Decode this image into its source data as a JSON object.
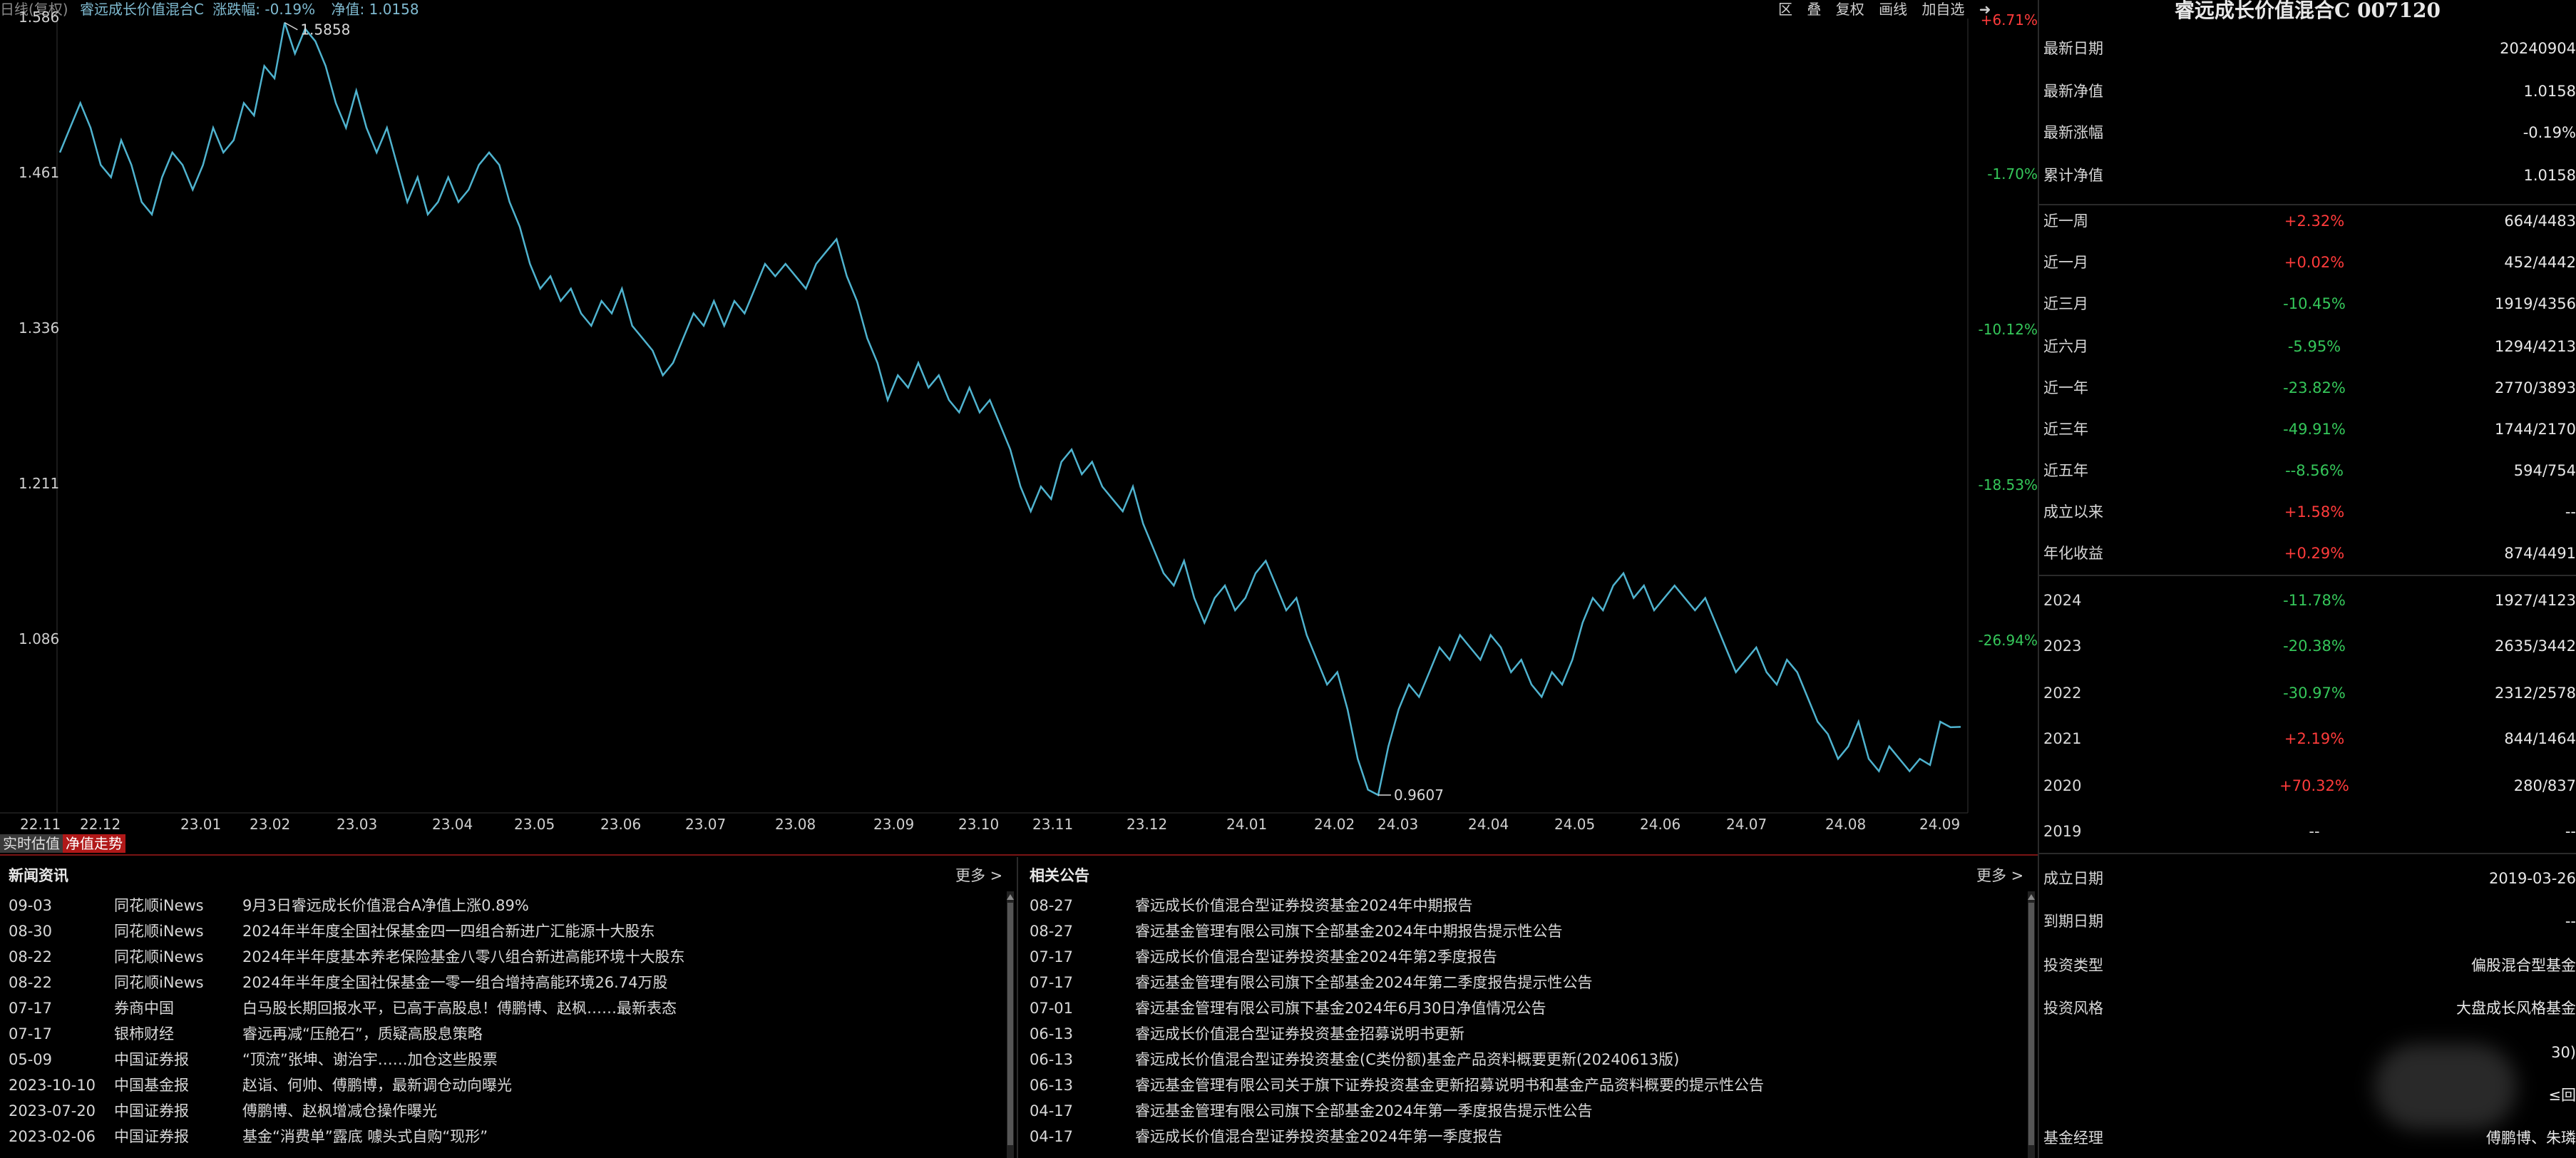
{
  "chart_header": {
    "kline_label": "日线(复权)",
    "fund_name": "睿远成长价值混合C",
    "change_label": "涨跌幅: -0.19%",
    "nav_label": "净值: 1.0158"
  },
  "chart_tools": [
    "区",
    "叠",
    "复权",
    "画线",
    "加自选"
  ],
  "chart_tabs": {
    "realtime": "实时估值",
    "nav_trend": "净值走势"
  },
  "colors": {
    "line": "#4fb3cf",
    "up": "#ff3b3b",
    "down": "#35c75a",
    "background": "#000000"
  },
  "chart_data": {
    "type": "line",
    "title": "",
    "ylim": [
      0.9607,
      1.586
    ],
    "y_ticks": [
      "1.586",
      "1.461",
      "1.336",
      "1.211",
      "1.086"
    ],
    "pct_ticks": [
      {
        "label": "+6.71%",
        "dir": "up",
        "y": 1.586
      },
      {
        "label": "-1.70%",
        "dir": "down",
        "y": 1.461
      },
      {
        "label": "-10.12%",
        "dir": "down",
        "y": 1.336
      },
      {
        "label": "-18.53%",
        "dir": "down",
        "y": 1.211
      },
      {
        "label": "-26.94%",
        "dir": "down",
        "y": 1.086
      }
    ],
    "x_ticks": [
      "22.11",
      "22.12",
      "23.01",
      "23.02",
      "23.03",
      "23.04",
      "23.05",
      "23.06",
      "23.07",
      "23.08",
      "23.09",
      "23.10",
      "23.11",
      "23.12",
      "24.01",
      "24.02",
      "24.03",
      "24.04",
      "24.05",
      "24.06",
      "24.07",
      "24.08",
      "24.09"
    ],
    "max_label": "1.5858",
    "min_label": "0.9607",
    "series": [
      {
        "values": [
          1.48,
          1.5,
          1.52,
          1.5,
          1.47,
          1.46,
          1.49,
          1.47,
          1.44,
          1.43,
          1.46,
          1.48,
          1.47,
          1.45,
          1.47,
          1.5,
          1.48,
          1.49,
          1.52,
          1.51,
          1.55,
          1.54,
          1.585,
          1.56,
          1.58,
          1.57,
          1.55,
          1.52,
          1.5,
          1.53,
          1.5,
          1.48,
          1.5,
          1.47,
          1.44,
          1.46,
          1.43,
          1.44,
          1.46,
          1.44,
          1.45,
          1.47,
          1.48,
          1.47,
          1.44,
          1.42,
          1.39,
          1.37,
          1.38,
          1.36,
          1.37,
          1.35,
          1.34,
          1.36,
          1.35,
          1.37,
          1.34,
          1.33,
          1.32,
          1.3,
          1.31,
          1.33,
          1.35,
          1.34,
          1.36,
          1.34,
          1.36,
          1.35,
          1.37,
          1.39,
          1.38,
          1.39,
          1.38,
          1.37,
          1.39,
          1.4,
          1.41,
          1.38,
          1.36,
          1.33,
          1.31,
          1.28,
          1.3,
          1.29,
          1.31,
          1.29,
          1.3,
          1.28,
          1.27,
          1.29,
          1.27,
          1.28,
          1.26,
          1.24,
          1.21,
          1.19,
          1.21,
          1.2,
          1.23,
          1.24,
          1.22,
          1.23,
          1.21,
          1.2,
          1.19,
          1.21,
          1.18,
          1.16,
          1.14,
          1.13,
          1.15,
          1.12,
          1.1,
          1.12,
          1.13,
          1.11,
          1.12,
          1.14,
          1.15,
          1.13,
          1.11,
          1.12,
          1.09,
          1.07,
          1.05,
          1.06,
          1.03,
          0.99,
          0.965,
          0.9607,
          1.0,
          1.03,
          1.05,
          1.04,
          1.06,
          1.08,
          1.07,
          1.09,
          1.08,
          1.07,
          1.09,
          1.08,
          1.06,
          1.07,
          1.05,
          1.04,
          1.06,
          1.05,
          1.07,
          1.1,
          1.12,
          1.11,
          1.13,
          1.14,
          1.12,
          1.13,
          1.11,
          1.12,
          1.13,
          1.12,
          1.11,
          1.12,
          1.1,
          1.08,
          1.06,
          1.07,
          1.08,
          1.06,
          1.05,
          1.07,
          1.06,
          1.04,
          1.02,
          1.01,
          0.99,
          1.0,
          1.02,
          0.99,
          0.98,
          1.0,
          0.99,
          0.98,
          0.99,
          0.985,
          1.02,
          1.0155,
          1.0158
        ]
      }
    ]
  },
  "info": {
    "title": "睿远成长价值混合C 007120",
    "basic": [
      {
        "label": "最新日期",
        "value": "20240904",
        "dir": ""
      },
      {
        "label": "最新净值",
        "value": "1.0158",
        "dir": ""
      },
      {
        "label": "最新涨幅",
        "value": "-0.19%",
        "dir": "down"
      },
      {
        "label": "累计净值",
        "value": "1.0158",
        "dir": ""
      }
    ],
    "periods": [
      {
        "label": "近一周",
        "change": "+2.32%",
        "rank": "664/4483",
        "dir": "up"
      },
      {
        "label": "近一月",
        "change": "+0.02%",
        "rank": "452/4442",
        "dir": "up"
      },
      {
        "label": "近三月",
        "change": "-10.45%",
        "rank": "1919/4356",
        "dir": "down"
      },
      {
        "label": "近六月",
        "change": "-5.95%",
        "rank": "1294/4213",
        "dir": "down"
      },
      {
        "label": "近一年",
        "change": "-23.82%",
        "rank": "2770/3893",
        "dir": "down"
      },
      {
        "label": "近三年",
        "change": "-49.91%",
        "rank": "1744/2170",
        "dir": "down"
      },
      {
        "label": "近五年",
        "change": "--8.56%",
        "rank": "594/754",
        "dir": "down"
      },
      {
        "label": "成立以来",
        "change": "+1.58%",
        "rank": "--",
        "dir": "up"
      },
      {
        "label": "年化收益",
        "change": "+0.29%",
        "rank": "874/4491",
        "dir": "up"
      }
    ],
    "years": [
      {
        "label": "2024",
        "change": "-11.78%",
        "rank": "1927/4123",
        "dir": "down"
      },
      {
        "label": "2023",
        "change": "-20.38%",
        "rank": "2635/3442",
        "dir": "down"
      },
      {
        "label": "2022",
        "change": "-30.97%",
        "rank": "2312/2578",
        "dir": "down"
      },
      {
        "label": "2021",
        "change": "+2.19%",
        "rank": "844/1464",
        "dir": "up"
      },
      {
        "label": "2020",
        "change": "+70.32%",
        "rank": "280/837",
        "dir": "up"
      },
      {
        "label": "2019",
        "change": "--",
        "rank": "--",
        "dir": ""
      }
    ],
    "profile": [
      {
        "label": "成立日期",
        "value": "2019-03-26"
      },
      {
        "label": "到期日期",
        "value": "--"
      },
      {
        "label": "投资类型",
        "value": "偏股混合型基金"
      },
      {
        "label": "投资风格",
        "value": "大盘成长风格基金"
      },
      {
        "label": "",
        "value": "30)"
      },
      {
        "label": "",
        "value": "≤回"
      },
      {
        "label": "基金经理",
        "value": "傅鹏博、朱璘"
      }
    ]
  },
  "news": {
    "title": "新闻资讯",
    "more": "更多 >",
    "items": [
      {
        "date": "09-03",
        "source": "同花顺iNews",
        "headline": "9月3日睿远成长价值混合A净值上涨0.89%"
      },
      {
        "date": "08-30",
        "source": "同花顺iNews",
        "headline": "2024年半年度全国社保基金四一四组合新进广汇能源十大股东"
      },
      {
        "date": "08-22",
        "source": "同花顺iNews",
        "headline": "2024年半年度基本养老保险基金八零八组合新进高能环境十大股东"
      },
      {
        "date": "08-22",
        "source": "同花顺iNews",
        "headline": "2024年半年度全国社保基金一零一组合增持高能环境26.74万股"
      },
      {
        "date": "07-17",
        "source": "券商中国",
        "headline": "白马股长期回报水平，已高于高股息！傅鹏博、赵枫……最新表态"
      },
      {
        "date": "07-17",
        "source": "银柿财经",
        "headline": "睿远再减“压舱石”，质疑高股息策略"
      },
      {
        "date": "05-09",
        "source": "中国证券报",
        "headline": "“顶流”张坤、谢治宇……加仓这些股票"
      },
      {
        "date": "2023-10-10",
        "source": "中国基金报",
        "headline": "赵诣、何帅、傅鹏博，最新调仓动向曝光"
      },
      {
        "date": "2023-07-20",
        "source": "中国证券报",
        "headline": "傅鹏博、赵枫增减仓操作曝光"
      },
      {
        "date": "2023-02-06",
        "source": "中国证券报",
        "headline": "基金“消费单”露底 噱头式自购“现形”"
      }
    ]
  },
  "announcements": {
    "title": "相关公告",
    "more": "更多 >",
    "items": [
      {
        "date": "08-27",
        "headline": "睿远成长价值混合型证券投资基金2024年中期报告"
      },
      {
        "date": "08-27",
        "headline": "睿远基金管理有限公司旗下全部基金2024年中期报告提示性公告"
      },
      {
        "date": "07-17",
        "headline": "睿远成长价值混合型证券投资基金2024年第2季度报告"
      },
      {
        "date": "07-17",
        "headline": "睿远基金管理有限公司旗下全部基金2024年第二季度报告提示性公告"
      },
      {
        "date": "07-01",
        "headline": "睿远基金管理有限公司旗下基金2024年6月30日净值情况公告"
      },
      {
        "date": "06-13",
        "headline": "睿远成长价值混合型证券投资基金招募说明书更新"
      },
      {
        "date": "06-13",
        "headline": "睿远成长价值混合型证券投资基金(C类份额)基金产品资料概要更新(20240613版)"
      },
      {
        "date": "06-13",
        "headline": "睿远基金管理有限公司关于旗下证券投资基金更新招募说明书和基金产品资料概要的提示性公告"
      },
      {
        "date": "04-17",
        "headline": "睿远基金管理有限公司旗下全部基金2024年第一季度报告提示性公告"
      },
      {
        "date": "04-17",
        "headline": "睿远成长价值混合型证券投资基金2024年第一季度报告"
      }
    ]
  }
}
